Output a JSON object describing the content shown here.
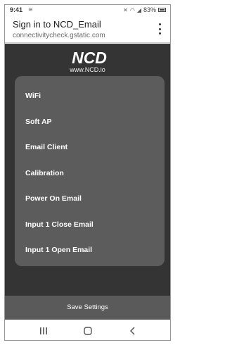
{
  "status_bar": {
    "time": "9:41",
    "battery": "83%"
  },
  "app_bar": {
    "title": "Sign in to NCD_Email",
    "subtitle": "connectivitycheck.gstatic.com"
  },
  "header": {
    "logo_text": "NCD",
    "url": "www.NCD.io"
  },
  "menu": {
    "items": [
      {
        "label": "WiFi"
      },
      {
        "label": "Soft AP"
      },
      {
        "label": "Email Client"
      },
      {
        "label": "Calibration"
      },
      {
        "label": "Power On Email"
      },
      {
        "label": "Input 1 Close Email"
      },
      {
        "label": "Input 1 Open Email"
      }
    ]
  },
  "footer": {
    "save_label": "Save Settings"
  },
  "nav": {
    "recents_icon": "recents-icon",
    "home_icon": "home-icon",
    "back_icon": "back-icon"
  }
}
